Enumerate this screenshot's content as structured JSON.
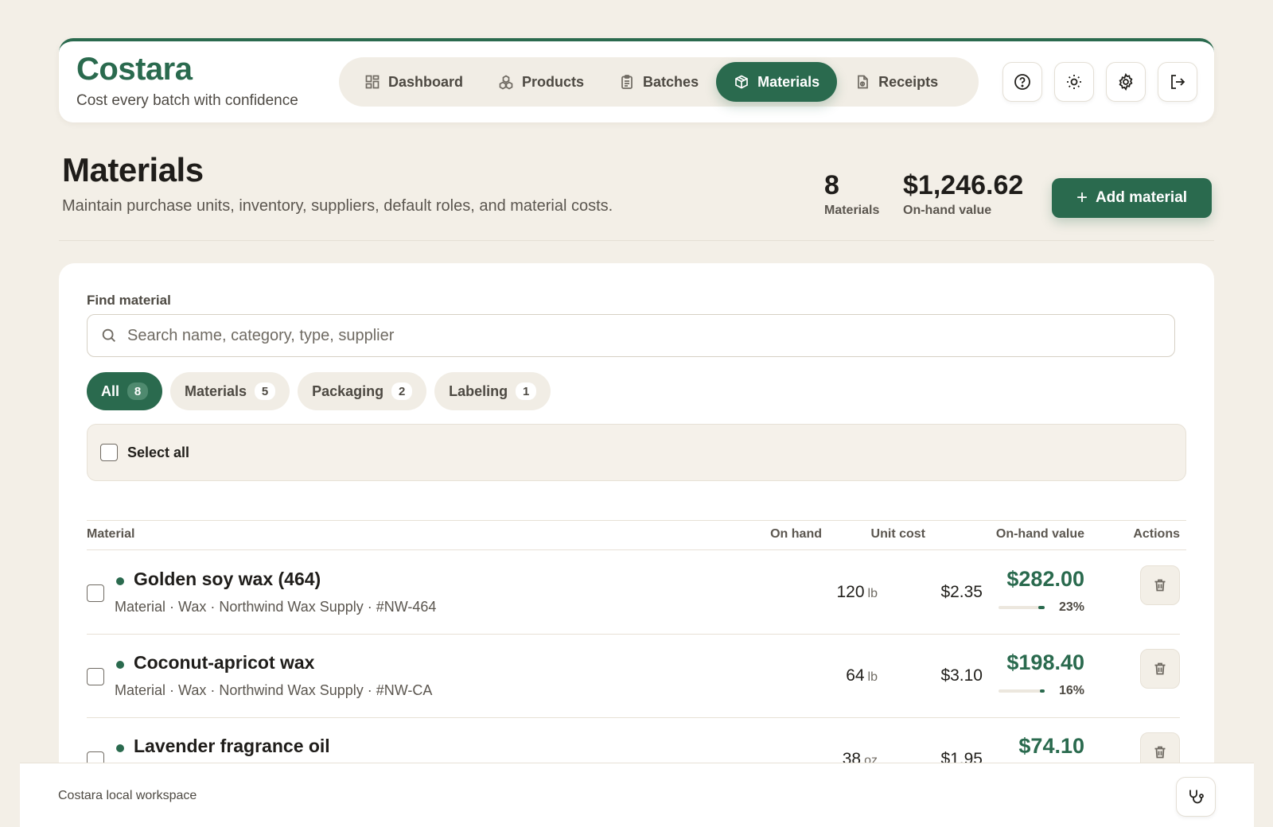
{
  "brand": {
    "name": "Costara",
    "tagline": "Cost every batch with confidence"
  },
  "nav": [
    {
      "label": "Dashboard",
      "icon": "dashboard-icon"
    },
    {
      "label": "Products",
      "icon": "products-icon"
    },
    {
      "label": "Batches",
      "icon": "clipboard-icon"
    },
    {
      "label": "Materials",
      "icon": "package-icon",
      "active": true
    },
    {
      "label": "Receipts",
      "icon": "receipt-icon"
    }
  ],
  "header_actions": [
    "help-icon",
    "theme-icon",
    "settings-icon",
    "logout-icon"
  ],
  "page": {
    "title": "Materials",
    "subtitle": "Maintain purchase units, inventory, suppliers, default roles, and material costs.",
    "stats": [
      {
        "value": "8",
        "label": "Materials"
      },
      {
        "value": "$1,246.62",
        "label": "On-hand value"
      }
    ],
    "add_button": "Add material"
  },
  "search": {
    "label": "Find material",
    "placeholder": "Search name, category, type, supplier",
    "value": ""
  },
  "filters": [
    {
      "label": "All",
      "count": "8",
      "active": true
    },
    {
      "label": "Materials",
      "count": "5"
    },
    {
      "label": "Packaging",
      "count": "2"
    },
    {
      "label": "Labeling",
      "count": "1"
    }
  ],
  "select_all_label": "Select all",
  "table": {
    "headers": {
      "material": "Material",
      "on_hand": "On hand",
      "unit_cost": "Unit cost",
      "value": "On-hand value",
      "actions": "Actions"
    },
    "rows": [
      {
        "name": "Golden soy wax (464)",
        "meta": "Material · Wax · Northwind Wax Supply · #NW-464",
        "qty": "120",
        "unit": "lb",
        "unit_cost": "$2.35",
        "value": "$282.00",
        "share_label": "23%",
        "share": 0.23
      },
      {
        "name": "Coconut-apricot wax",
        "meta": "Material · Wax · Northwind Wax Supply · #NW-CA",
        "qty": "64",
        "unit": "lb",
        "unit_cost": "$3.10",
        "value": "$198.40",
        "share_label": "16%",
        "share": 0.16
      },
      {
        "name": "Lavender fragrance oil",
        "meta": "",
        "qty": "38",
        "unit": "oz",
        "unit_cost": "$1.95",
        "value": "$74.10",
        "share_label": "",
        "share": 0.06
      }
    ]
  },
  "footer": {
    "text": "Costara local workspace",
    "icon": "stethoscope-icon"
  },
  "colors": {
    "accent": "#2a6a4e",
    "background": "#f3efe7",
    "surface": "#ffffff"
  }
}
